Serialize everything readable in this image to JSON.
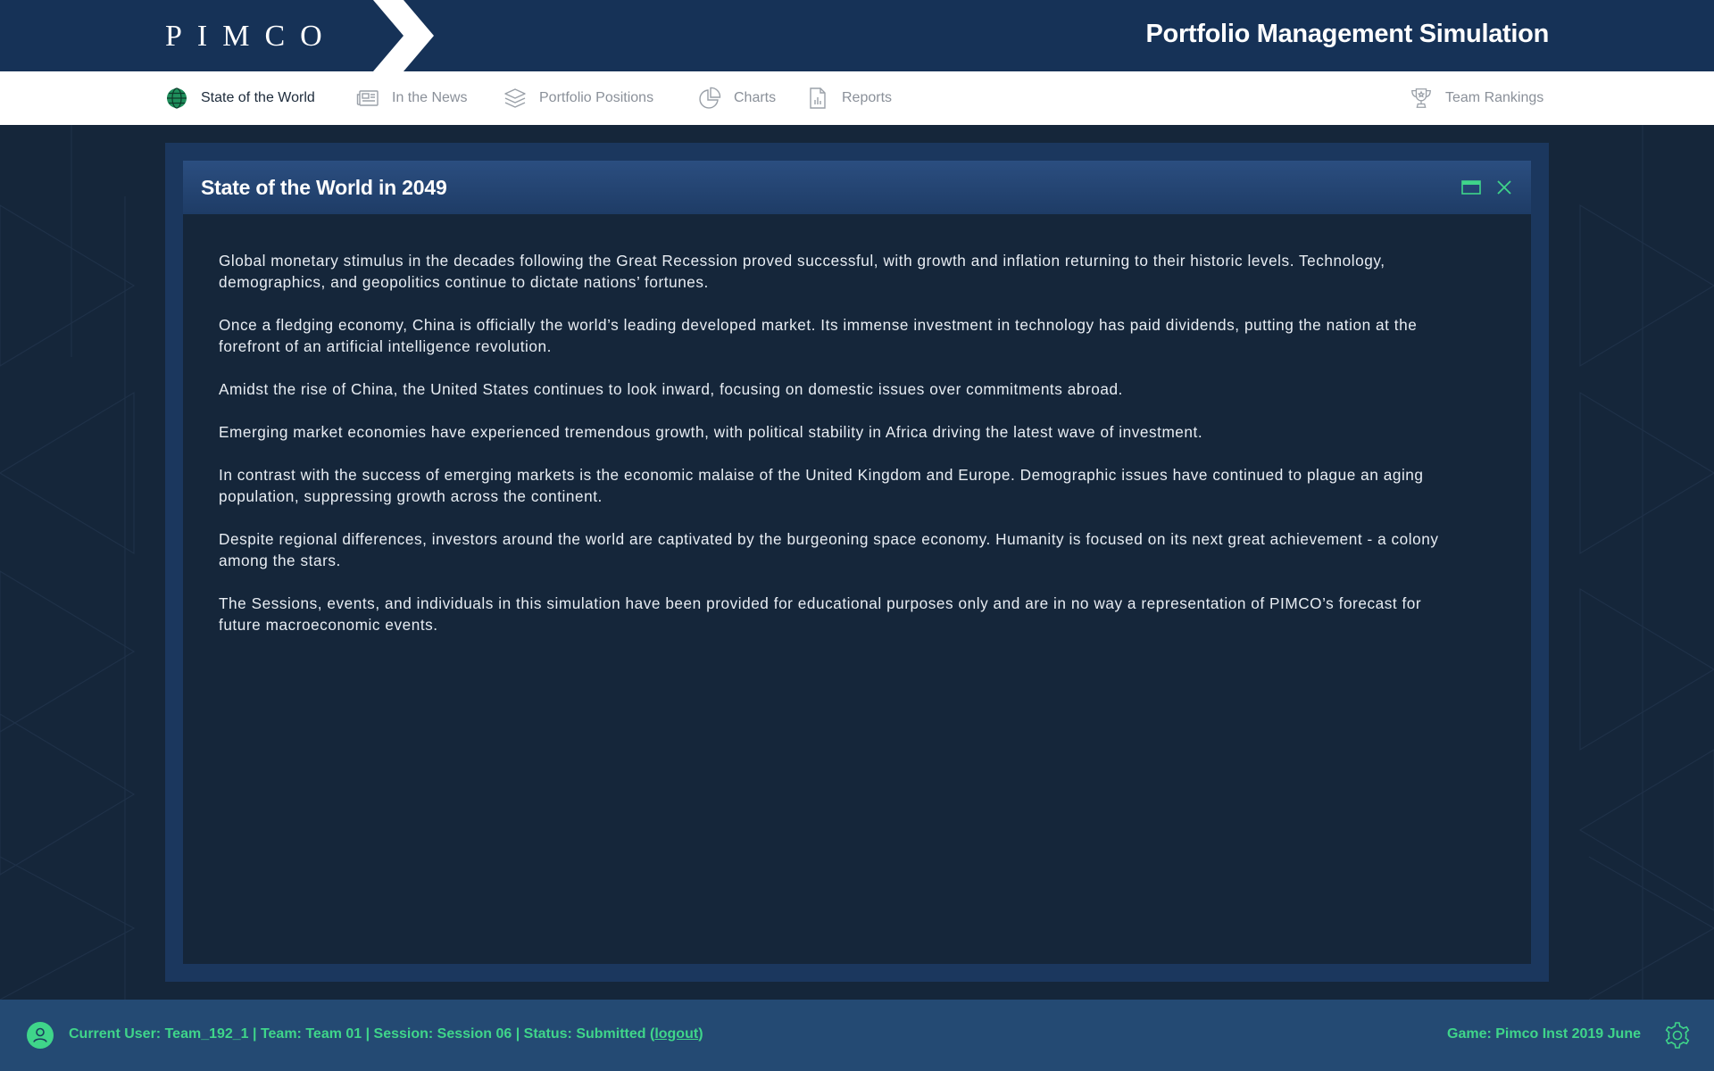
{
  "header": {
    "logo_text": "PIMCO",
    "app_title": "Portfolio Management Simulation"
  },
  "nav": {
    "items": [
      {
        "label": "State of the World",
        "icon": "globe-icon",
        "active": true
      },
      {
        "label": "In the News",
        "icon": "newspaper-icon",
        "active": false
      },
      {
        "label": "Portfolio Positions",
        "icon": "layers-icon",
        "active": false
      },
      {
        "label": "Charts",
        "icon": "pie-chart-icon",
        "active": false
      },
      {
        "label": "Reports",
        "icon": "report-icon",
        "active": false
      }
    ],
    "rankings": {
      "label": "Team Rankings",
      "icon": "trophy-icon"
    }
  },
  "panel": {
    "title": "State of the World in 2049",
    "paragraphs": [
      "Global monetary stimulus in the decades following the Great Recession proved successful, with growth and inflation returning to their historic levels. Technology, demographics, and geopolitics continue to dictate nations’ fortunes.",
      "Once a fledging economy, China is officially the world’s leading developed market. Its immense investment in technology has paid dividends, putting the nation at the forefront of an artificial intelligence revolution.",
      "Amidst the rise of China, the United States continues to look inward, focusing on domestic issues over commitments abroad.",
      "Emerging market economies have experienced tremendous growth, with political stability in Africa driving the latest wave of investment.",
      "In contrast with the success of emerging markets is the economic malaise of the United Kingdom and Europe. Demographic issues have continued to plague an aging population, suppressing growth across the continent.",
      "Despite regional differences, investors around the world are captivated by the burgeoning space economy. Humanity is focused on its next great achievement - a colony among the stars.",
      "The Sessions, events, and individuals in this simulation have been provided for educational purposes only and are in no way a representation of PIMCO’s forecast for future macroeconomic events."
    ]
  },
  "footer": {
    "status_prefix": "Current User: Team_192_1 | Team: Team 01 | Session: Session 06 | Status: Submitted (",
    "logout_label": "logout",
    "status_suffix": ")",
    "game_label": "Game: Pimco Inst 2019 June"
  },
  "colors": {
    "header_bg": "#163257",
    "page_bg": "#15263a",
    "panel_border": "#1b375e",
    "footer_bg": "#244a73",
    "accent_green": "#3fd58a"
  }
}
